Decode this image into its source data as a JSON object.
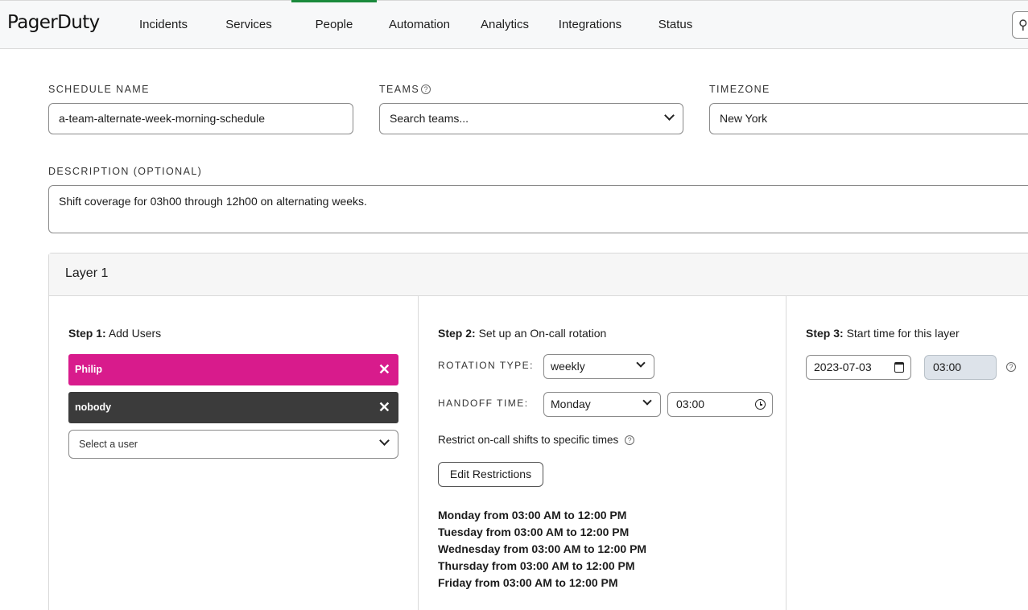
{
  "nav": {
    "logo": "PagerDuty",
    "items": [
      {
        "label": "Incidents"
      },
      {
        "label": "Services"
      },
      {
        "label": "People",
        "active": true
      },
      {
        "label": "Automation"
      },
      {
        "label": "Analytics"
      },
      {
        "label": "Integrations"
      },
      {
        "label": "Status"
      }
    ],
    "search_icon": "search-icon",
    "accent_color": "#1a8a3c"
  },
  "form": {
    "schedule_name_label": "SCHEDULE NAME",
    "schedule_name_value": "a-team-alternate-week-morning-schedule",
    "teams_label": "TEAMS",
    "teams_placeholder": "Search teams...",
    "timezone_label": "TIMEZONE",
    "timezone_value": "New York",
    "description_label": "DESCRIPTION (OPTIONAL)",
    "description_value": "Shift coverage for 03h00 through 12h00 on alternating weeks."
  },
  "layer": {
    "title": "Layer 1",
    "step1": {
      "prefix": "Step 1:",
      "text": "Add Users",
      "users": [
        {
          "name": "Philip",
          "color": "#d81b8c"
        },
        {
          "name": "nobody",
          "color": "#3b3b3b"
        }
      ],
      "remove_glyph": "✕",
      "select_placeholder": "Select a user"
    },
    "step2": {
      "prefix": "Step 2:",
      "text": "Set up an On-call rotation",
      "rotation_type_label": "ROTATION TYPE:",
      "rotation_type_value": "weekly",
      "handoff_time_label": "HANDOFF TIME:",
      "handoff_day_value": "Monday",
      "handoff_time_value": "03:00",
      "restrict_label": "Restrict on-call shifts to specific times",
      "edit_button": "Edit Restrictions",
      "restrictions": [
        "Monday from 03:00 AM to 12:00 PM",
        "Tuesday from 03:00 AM to 12:00 PM",
        "Wednesday from 03:00 AM to 12:00 PM",
        "Thursday from 03:00 AM to 12:00 PM",
        "Friday from 03:00 AM to 12:00 PM"
      ]
    },
    "step3": {
      "prefix": "Step 3:",
      "text": "Start time for this layer",
      "start_date_value": "2023-07-03",
      "start_time_value": "03:00"
    }
  }
}
